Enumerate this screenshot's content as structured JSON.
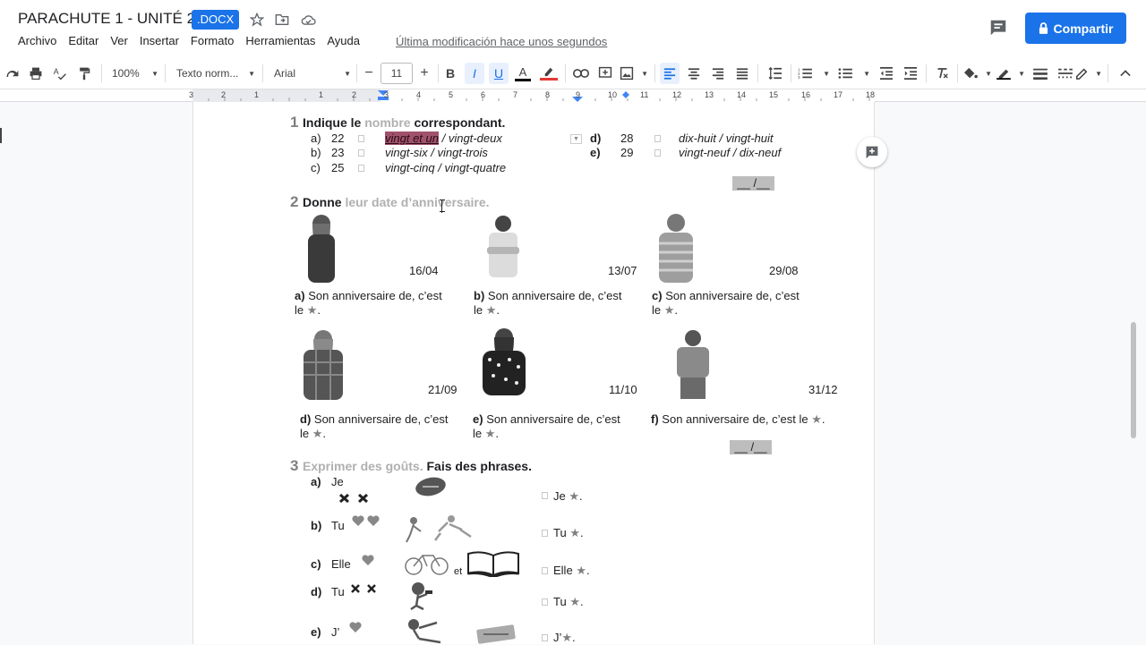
{
  "header": {
    "title": "PARACHUTE 1 - UNITÉ 2",
    "badge": ".DOCX",
    "menu": [
      "Archivo",
      "Editar",
      "Ver",
      "Insertar",
      "Formato",
      "Herramientas",
      "Ayuda"
    ],
    "last_edit": "Última modificación hace unos segundos",
    "share_label": "Compartir"
  },
  "toolbar": {
    "zoom": "100%",
    "style": "Texto norm...",
    "font": "Arial",
    "font_size": "11",
    "minus": "−",
    "plus": "+",
    "bold": "B",
    "italic": "I",
    "underline": "U",
    "text_color": "A"
  },
  "ruler": {
    "numbers": [
      "3",
      "2",
      "1",
      "1",
      "2",
      "3",
      "4",
      "5",
      "6",
      "7",
      "8",
      "9",
      "10",
      "11",
      "12",
      "13",
      "14",
      "15",
      "16",
      "17",
      "18"
    ]
  },
  "colors": {
    "accent": "#1a73e8",
    "highlight": "#a0526b"
  },
  "doc": {
    "s1": {
      "num": "1",
      "title_a": "Indique le ",
      "title_b": "nombre",
      "title_c": " correspondant.",
      "items_left": [
        {
          "letter": "a)",
          "num": "22",
          "answer_hl": "vingt et un",
          "answer": " / vingt-deux"
        },
        {
          "letter": "b)",
          "num": "23",
          "answer": "vingt-six / vingt-trois"
        },
        {
          "letter": "c)",
          "num": "25",
          "answer": "vingt-cinq / vingt-quatre"
        }
      ],
      "items_right": [
        {
          "letter": "d)",
          "num": "28",
          "answer": "dix-huit / vingt-huit"
        },
        {
          "letter": "e)",
          "num": "29",
          "answer": "vingt-neuf / dix-neuf"
        }
      ],
      "score": "__ /__"
    },
    "s2": {
      "num": "2",
      "title_a": "Donne ",
      "title_b": "leur date d’anniversaire.",
      "dates": [
        "16/04",
        "13/07",
        "29/08",
        "21/09",
        "11/10",
        "31/12"
      ],
      "letters": [
        "a)",
        "b)",
        "c)",
        "d)",
        "e)",
        "f)"
      ],
      "sentence": "Son anniversaire de, c’est",
      "sentence_full": "Son anniversaire de, c’est le",
      "le": "le",
      "star": "★",
      "dot": ".",
      "score": "__ /__"
    },
    "s3": {
      "num": "3",
      "title_a": "Exprimer des goûts.",
      "title_b": " Fais des phrases.",
      "rows": [
        {
          "letter": "a)",
          "subject": "Je",
          "answer": "Je"
        },
        {
          "letter": "b)",
          "subject": "Tu",
          "answer": "Tu"
        },
        {
          "letter": "c)",
          "subject": "Elle",
          "answer": "Elle"
        },
        {
          "letter": "d)",
          "subject": "Tu",
          "answer": "Tu"
        },
        {
          "letter": "e)",
          "subject": "J’",
          "answer": "J’"
        }
      ],
      "et": "et"
    }
  }
}
